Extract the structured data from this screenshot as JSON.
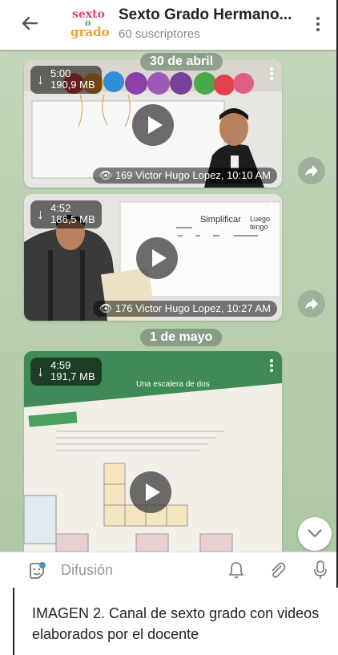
{
  "header": {
    "title": "Sexto Grado Hermano...",
    "subscribers": "60 suscriptores",
    "logo_lines": [
      "sexto",
      "o",
      "grado"
    ]
  },
  "dates": [
    "30 de abril",
    "1 de mayo"
  ],
  "messages": [
    {
      "duration": "5:00",
      "size": "190,9 MB",
      "footer": "169  Victor Hugo Lopez, 10:10 AM"
    },
    {
      "duration": "4:52",
      "size": "186,5 MB",
      "footer": "176  Victor Hugo Lopez, 10:27 AM",
      "board_text": [
        "Simplificar",
        "Luego tengo"
      ]
    },
    {
      "duration": "4:59",
      "size": "191,7 MB",
      "book_text": "Una escalera de dos"
    }
  ],
  "input": {
    "placeholder": "Difusión"
  },
  "caption": "IMAGEN 2. Canal de sexto grado con videos elaborados por el docente",
  "colors": {
    "chat_bg": "#b9cfb0",
    "accent": "#4a90c8"
  }
}
